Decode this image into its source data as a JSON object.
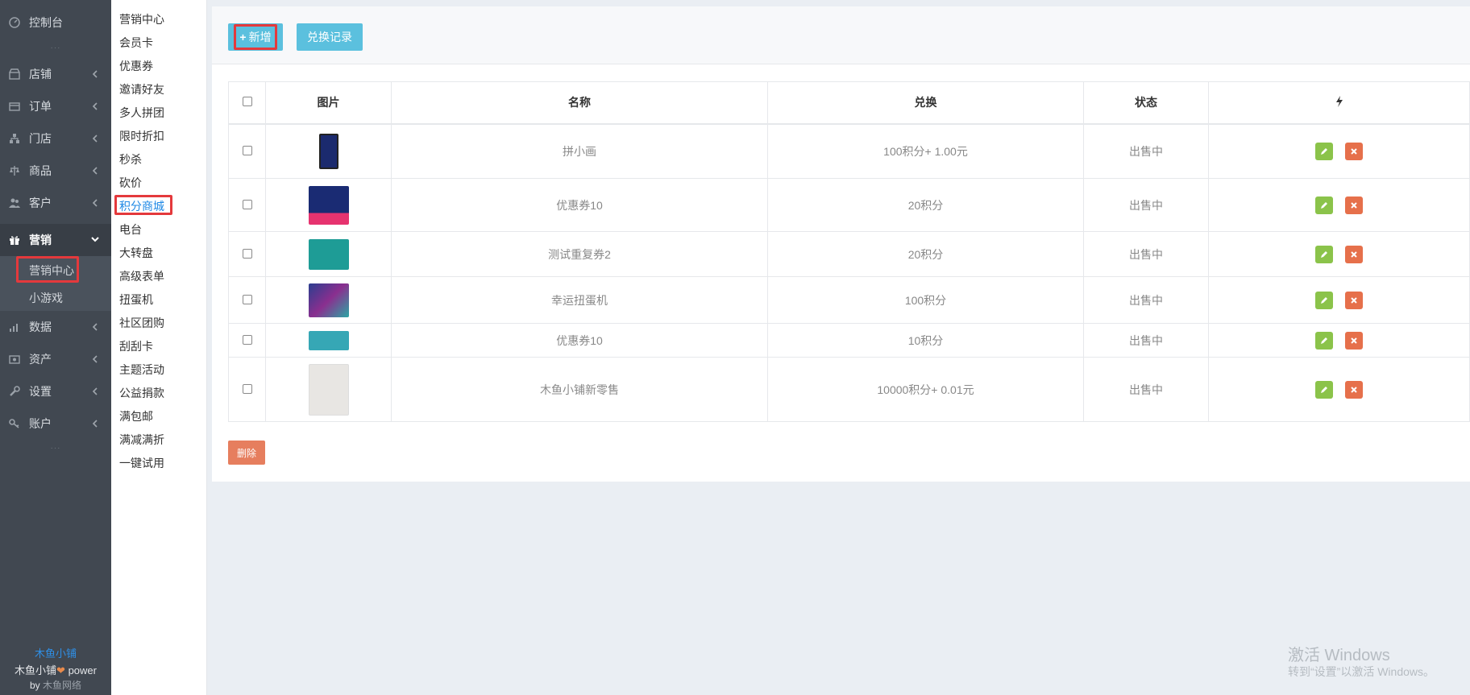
{
  "sidebar": {
    "dashboard": "控制台",
    "items": [
      {
        "label": "店铺",
        "icon": "shop-icon"
      },
      {
        "label": "订单",
        "icon": "order-icon"
      },
      {
        "label": "门店",
        "icon": "store-icon"
      },
      {
        "label": "商品",
        "icon": "product-icon"
      },
      {
        "label": "客户",
        "icon": "customer-icon"
      },
      {
        "label": "营销",
        "icon": "gift-icon"
      },
      {
        "label": "数据",
        "icon": "data-icon"
      },
      {
        "label": "资产",
        "icon": "asset-icon"
      },
      {
        "label": "设置",
        "icon": "wrench-icon"
      },
      {
        "label": "账户",
        "icon": "key-icon"
      }
    ],
    "sub_items": [
      "营销中心",
      "小游戏"
    ],
    "footer": {
      "brand": "木鱼小铺",
      "power_prefix": "木鱼小铺",
      "power_suffix": "power",
      "by": "by",
      "company": "木鱼网络"
    }
  },
  "submenu": [
    "营销中心",
    "会员卡",
    "优惠券",
    "邀请好友",
    "多人拼团",
    "限时折扣",
    "秒杀",
    "砍价",
    "积分商城",
    "电台",
    "大转盘",
    "高级表单",
    "扭蛋机",
    "社区团购",
    "刮刮卡",
    "主题活动",
    "公益捐款",
    "满包邮",
    "满减满折",
    "一键试用"
  ],
  "toolbar": {
    "add_label": "新增",
    "log_label": "兑换记录"
  },
  "table": {
    "headers": [
      "图片",
      "名称",
      "兑换",
      "状态"
    ],
    "rows": [
      {
        "name": "拼小画",
        "exchange": "100积分+ 1.00元",
        "status": "出售中"
      },
      {
        "name": "优惠券10",
        "exchange": "20积分",
        "status": "出售中"
      },
      {
        "name": "测试重复券2",
        "exchange": "20积分",
        "status": "出售中"
      },
      {
        "name": "幸运扭蛋机",
        "exchange": "100积分",
        "status": "出售中"
      },
      {
        "name": "优惠券10",
        "exchange": "10积分",
        "status": "出售中"
      },
      {
        "name": "木鱼小铺新零售",
        "exchange": "10000积分+ 0.01元",
        "status": "出售中"
      }
    ]
  },
  "delete_label": "删除",
  "watermark": {
    "line1": "激活 Windows",
    "line2": "转到“设置”以激活 Windows。"
  },
  "colors": {
    "sidebar_bg": "#414851",
    "accent": "#5bc0de",
    "edit": "#8bc34a",
    "delete": "#e6704b",
    "highlight": "#e4393c",
    "link": "#1e88e5"
  }
}
